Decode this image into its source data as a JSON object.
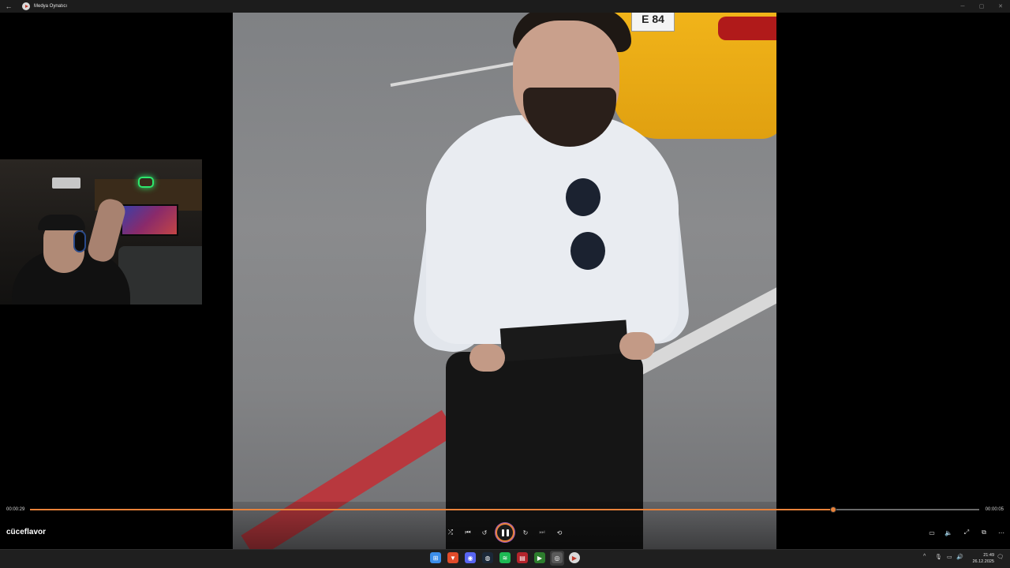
{
  "window": {
    "title": "Medya Oynatıcı",
    "back_glyph": "←",
    "minimize_glyph": "─",
    "maximize_glyph": "▢",
    "close_glyph": "✕"
  },
  "video": {
    "taxi_plate_text": "E 84"
  },
  "player": {
    "current_time": "00:00:29",
    "total_time": "00:00:05",
    "progress": 0.846,
    "media_title": "cüceflavor",
    "accent_color": "#e8823a",
    "controls": {
      "shuffle": "⤮",
      "previous": "⏮",
      "rewind": "↺",
      "forward": "↻",
      "next": "⏭",
      "repeat": "⟲",
      "subtitles": "▭",
      "volume": "🔈",
      "fullscreen": "⤢",
      "miniplayer": "⧉",
      "more": "⋯"
    }
  },
  "taskbar": {
    "apps": [
      {
        "name": "windows-start-icon",
        "color": "#3b8eea",
        "glyph": "⊞"
      },
      {
        "name": "brave-icon",
        "color": "#e04b2a",
        "glyph": "▼"
      },
      {
        "name": "discord-icon",
        "color": "#5865f2",
        "glyph": "◉"
      },
      {
        "name": "steam-icon",
        "color": "#1b2838",
        "glyph": "◍"
      },
      {
        "name": "spotify-icon",
        "color": "#1db954",
        "glyph": "≋"
      },
      {
        "name": "game-icon",
        "color": "#b4242b",
        "glyph": "▤"
      },
      {
        "name": "media-icon",
        "color": "#2d7d2d",
        "glyph": "▶"
      },
      {
        "name": "obs-icon",
        "color": "#5a5a5a",
        "glyph": "◎"
      },
      {
        "name": "media-player-icon",
        "color": "#d9d9d9",
        "glyph": "▶"
      }
    ],
    "tray": {
      "chevron": "^",
      "mic": "🎙",
      "network": "▭",
      "volume": "🔊",
      "notify": "🗨"
    },
    "time": "21:49",
    "date": "26.12.2025"
  }
}
